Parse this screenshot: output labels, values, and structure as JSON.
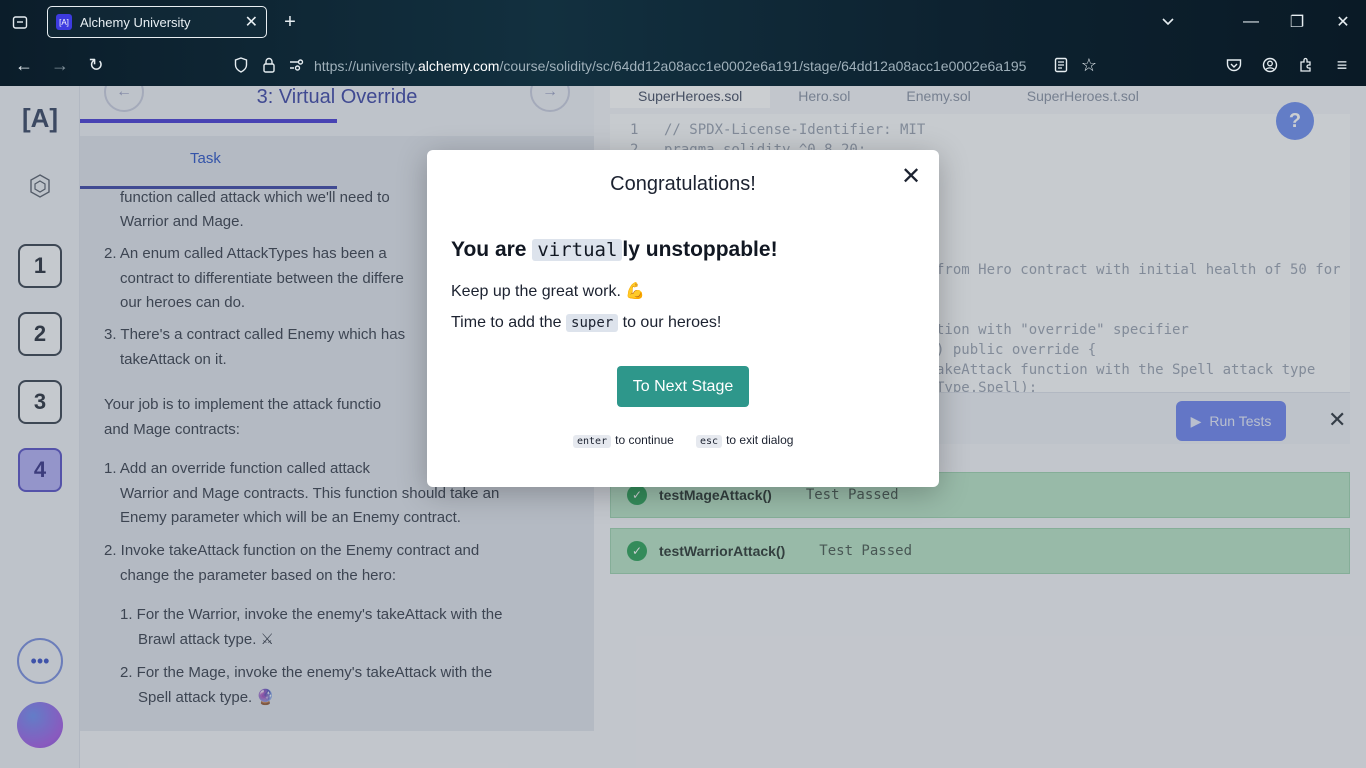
{
  "browser": {
    "tab_title": "Alchemy University",
    "favicon_text": "[A]",
    "url_prefix": "https://university.",
    "url_domain": "alchemy.com",
    "url_path": "/course/solidity/sc/64dd12a08acc1e0002e6a191/stage/64dd12a08acc1e0002e6a195",
    "icons": [
      "tab-list-icon",
      "close-icon",
      "plus-icon",
      "chevron-down-icon",
      "minimize-icon",
      "restore-icon",
      "window-close-icon",
      "back-icon",
      "forward-icon",
      "reload-icon",
      "shield-icon",
      "lock-icon",
      "permissions-icon",
      "reader-icon",
      "star-icon",
      "pocket-icon",
      "account-icon",
      "extensions-icon",
      "menu-icon"
    ]
  },
  "sidebar": {
    "logo": "[A]",
    "stages": [
      "1",
      "2",
      "3",
      "4"
    ],
    "active_stage": "4",
    "more": "•••"
  },
  "lesson": {
    "title": "3: Virtual Override",
    "progress": 0.5,
    "tab_task": "Task",
    "lines": [
      "function called attack which we'll need to",
      "Warrior and Mage.",
      "2. An enum called AttackTypes has been a",
      "contract to differentiate between the differe",
      "our heroes can do.",
      "3. There's a contract called Enemy which has",
      "takeAttack on it.",
      "Your job is to implement the attack functio",
      "and Mage contracts:",
      "1. Add an override function called attack",
      "Warrior and Mage contracts. This function should take an",
      "Enemy parameter which will be an Enemy contract.",
      "2. Invoke takeAttack function on the Enemy contract and",
      "change the parameter based on the hero:",
      "1. For the Warrior, invoke the enemy's takeAttack with the",
      "Brawl attack type. ⚔",
      "2. For the Mage, invoke the enemy's takeAttack with the",
      "Spell attack type. 🔮"
    ]
  },
  "editor": {
    "tabs": [
      "SuperHeroes.sol",
      "Hero.sol",
      "Enemy.sol",
      "SuperHeroes.t.sol"
    ],
    "active_tab": "SuperHeroes.sol",
    "code": [
      {
        "n": "1",
        "text": "// SPDX-License-Identifier: MIT"
      },
      {
        "n": "2",
        "text": "pragma solidity ^0.8.20;"
      },
      {
        "n": "",
        "text": "from Hero contract with initial health of 50 for"
      },
      {
        "n": "",
        "text": "tion with \"override\" specifier"
      },
      {
        "n": "",
        "text": ") public override {"
      },
      {
        "n": "",
        "text": "akeAttack function with the Spell attack type"
      },
      {
        "n": "",
        "text": "Type.Spell);"
      }
    ],
    "help": "?"
  },
  "tests": {
    "run_label": "Run Tests",
    "results": [
      {
        "name": "testMageAttack()",
        "status": "Test Passed"
      },
      {
        "name": "testWarriorAttack()",
        "status": "Test Passed"
      }
    ]
  },
  "modal": {
    "title": "Congratulations!",
    "headline_pre": "You are ",
    "headline_code": "virtual",
    "headline_post": "ly unstoppable!",
    "line1": "Keep up the great work. 💪",
    "line2_pre": "Time to add the ",
    "line2_code": "super",
    "line2_post": " to our heroes!",
    "next_button": "To Next Stage",
    "hint_enter_key": "enter",
    "hint_enter_text": "to continue",
    "hint_esc_key": "esc",
    "hint_esc_text": "to exit dialog"
  }
}
